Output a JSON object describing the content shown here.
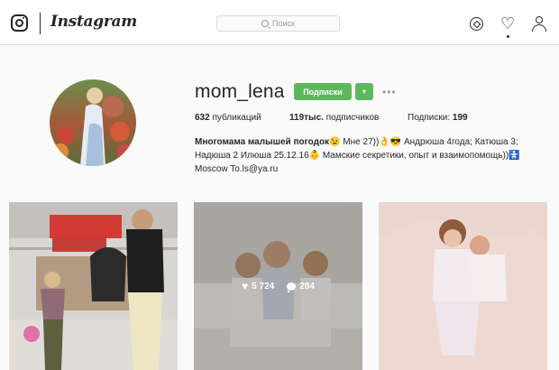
{
  "header": {
    "wordmark": "Instagram",
    "search_placeholder": "Поиск",
    "icons": [
      "instagram-logo-icon",
      "search-icon",
      "explore-icon",
      "heart-icon",
      "user-icon"
    ]
  },
  "profile": {
    "username": "mom_lena",
    "follow_label": "Подписки",
    "dropdown_glyph": "▾",
    "more_glyph": "•••",
    "stats": {
      "posts_count": "632",
      "posts_label": "публикаций",
      "followers_count": "119тыс.",
      "followers_label": "подписчиков",
      "following_label": "Подписки:",
      "following_count": "199"
    },
    "bio": {
      "name": "Многомама малышей погодок",
      "line1_rest": "😉 Мне 27))👌😎 Андрюша 4года; Катюша 3;",
      "line2": "Надюша 2 Илюша 25.12.16👶 Мамские секретики, опыт и взаимопомощь))🚼",
      "line3": "Moscow To.ls@ya.ru"
    }
  },
  "posts": [
    {
      "id": 1
    },
    {
      "id": 2,
      "likes": "5 724",
      "comments": "284"
    },
    {
      "id": 3
    }
  ],
  "colors": {
    "follow_button": "#5cb85c",
    "border": "#dbdbdb",
    "background": "#fafafa",
    "text": "#262626"
  }
}
